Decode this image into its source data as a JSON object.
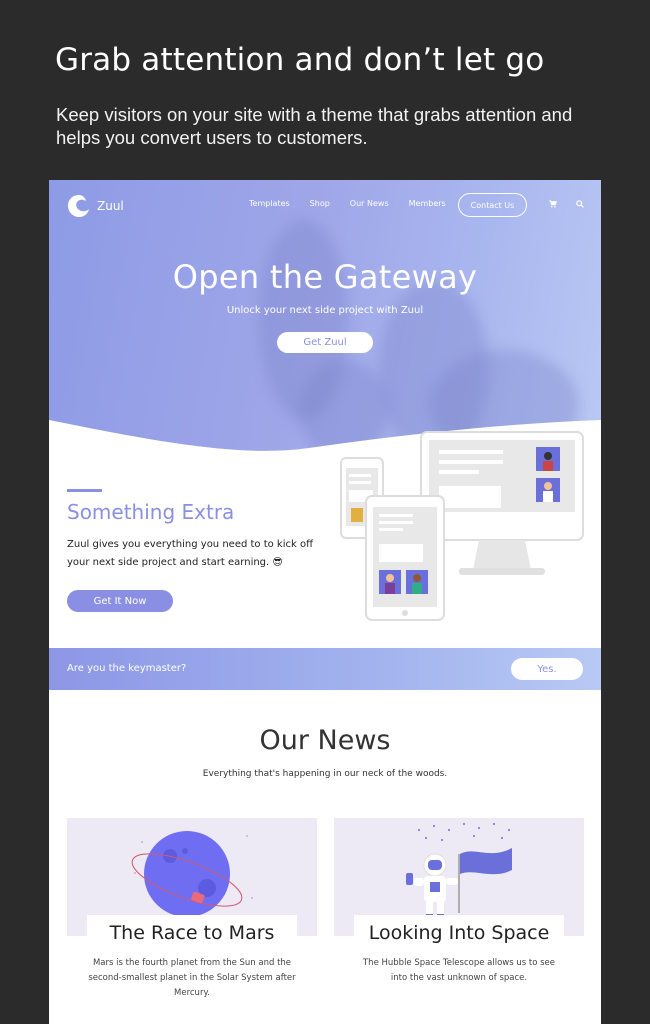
{
  "promo": {
    "title": "Grab attention and don’t let go",
    "subtitle": "Keep visitors on your site with a theme that grabs attention and helps you convert users to customers."
  },
  "site": {
    "logo_text": "Zuul",
    "nav": [
      "Templates",
      "Shop",
      "Our News",
      "Members"
    ],
    "contact_label": "Contact Us",
    "hero": {
      "title": "Open the Gateway",
      "subtitle": "Unlock your next side project with Zuul",
      "button": "Get Zuul"
    },
    "extra": {
      "title": "Something Extra",
      "text": "Zuul gives you everything you need to to kick off your next side project and start earning. 😎",
      "button": "Get It Now"
    },
    "band": {
      "text": "Are you the keymaster?",
      "button": "Yes."
    },
    "news": {
      "title": "Our News",
      "subtitle": "Everything that's happening in our neck of the woods.",
      "cards": [
        {
          "title": "The Race to Mars",
          "text": "Mars is the fourth planet from the Sun and the second-smallest planet in the Solar System after Mercury."
        },
        {
          "title": "Looking Into Space",
          "text": "The Hubble Space Telescope allows us to see into the vast unknown of space."
        }
      ]
    },
    "colors": {
      "accent": "#8b8fe4",
      "dark_bg": "#2b2b2b"
    }
  }
}
